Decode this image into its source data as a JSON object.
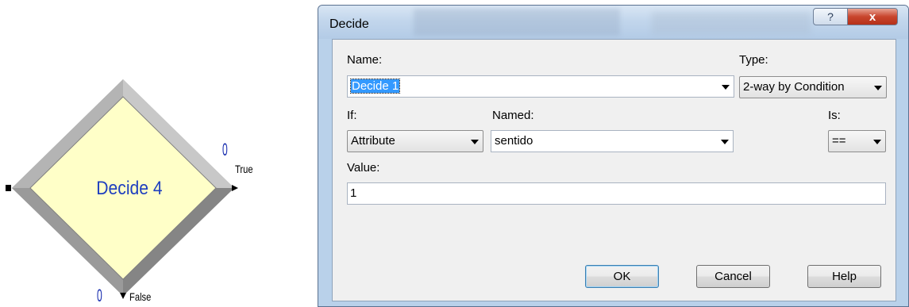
{
  "module": {
    "title": "Decide 4",
    "true_count": "0",
    "true_label": "True",
    "false_count": "0",
    "false_label": "False"
  },
  "dialog": {
    "title": "Decide",
    "help_icon": "?",
    "close_icon": "x",
    "name_label": "Name:",
    "name_value": "Decide 1",
    "type_label": "Type:",
    "type_value": "2-way by Condition",
    "if_label": "If:",
    "if_value": "Attribute",
    "named_label": "Named:",
    "named_value": "sentido",
    "is_label": "Is:",
    "is_value": "==",
    "value_label": "Value:",
    "value_value": "1",
    "ok_label": "OK",
    "cancel_label": "Cancel",
    "help_label": "Help"
  },
  "colors": {
    "module_fill": "#ffffc8",
    "module_text": "#1f3fbf",
    "count_text": "#1a2fb0",
    "selection": "#3399ff",
    "frame": "#b9d1ea"
  }
}
